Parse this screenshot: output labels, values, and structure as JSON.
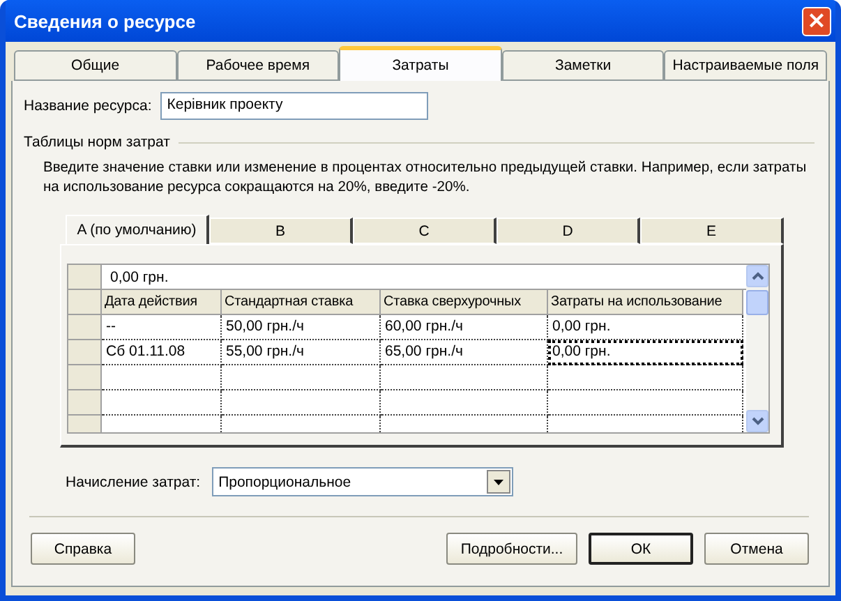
{
  "window": {
    "title": "Сведения о ресурсе",
    "close": "×"
  },
  "tabs": [
    {
      "label": "Общие",
      "selected": false
    },
    {
      "label": "Рабочее время",
      "selected": false
    },
    {
      "label": "Затраты",
      "selected": true
    },
    {
      "label": "Заметки",
      "selected": false
    },
    {
      "label": "Настраиваемые поля",
      "selected": false
    }
  ],
  "resource_name": {
    "label": "Название ресурса:",
    "value": "Керівник проекту"
  },
  "rate_tables": {
    "title": "Таблицы норм затрат",
    "description": "Введите значение ставки или изменение в процентах относительно предыдущей ставки. Например, если затраты на использование ресурса сокращаются на 20%, введите -20%.",
    "tabs": [
      {
        "label": "A (по умолчанию)",
        "selected": true
      },
      {
        "label": "B",
        "selected": false
      },
      {
        "label": "C",
        "selected": false
      },
      {
        "label": "D",
        "selected": false
      },
      {
        "label": "E",
        "selected": false
      }
    ],
    "edit_value": "0,00 грн.",
    "columns": [
      "Дата действия",
      "Стандартная ставка",
      "Ставка сверхурочных",
      "Затраты на использование"
    ],
    "rows": [
      {
        "cells": [
          {
            "text": "--",
            "selected": false
          },
          {
            "text": "50,00 грн./ч",
            "selected": false
          },
          {
            "text": "60,00 грн./ч",
            "selected": false
          },
          {
            "text": "0,00 грн.",
            "selected": false
          }
        ]
      },
      {
        "cells": [
          {
            "text": "Сб 01.11.08",
            "selected": false
          },
          {
            "text": "55,00 грн./ч",
            "selected": false
          },
          {
            "text": "65,00 грн./ч",
            "selected": false
          },
          {
            "text": "0,00 грн.",
            "selected": true
          }
        ]
      }
    ]
  },
  "accrual": {
    "label": "Начисление затрат:",
    "value": "Пропорциональное"
  },
  "buttons": [
    {
      "label": "Справка",
      "kind": "left",
      "default": false
    },
    {
      "label": "Подробности...",
      "kind": "right",
      "default": false
    },
    {
      "label": "ОК",
      "kind": "right",
      "default": true
    },
    {
      "label": "Отмена",
      "kind": "right",
      "default": false
    }
  ]
}
